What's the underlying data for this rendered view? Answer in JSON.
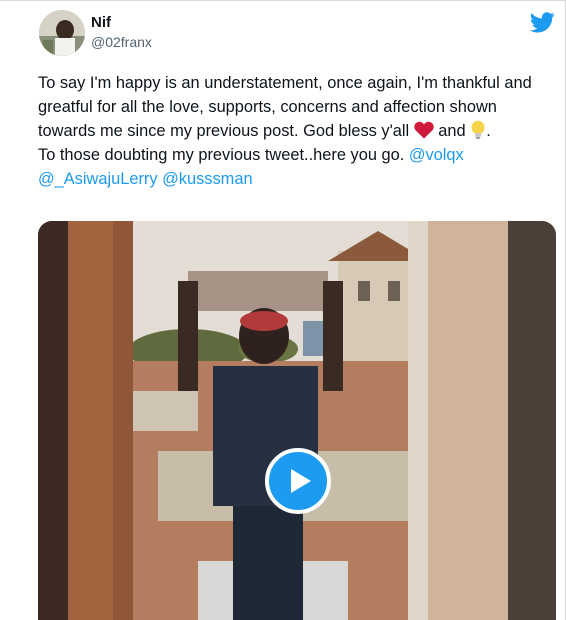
{
  "tweet": {
    "author_name": "Nif",
    "author_handle": "@02franx",
    "text_line1_a": "To say I'm happy is an understatement, once again, I'm thankful and greatful for all the love, supports, concerns  and affection shown towards me since my previous post. God bless y'all ",
    "text_line1_b": " and ",
    "text_line1_c": ".",
    "text_line2": "To those doubting my previous tweet..here you go. ",
    "mentions": [
      "@volqx",
      "@_AsiwajuLerry",
      "@kusssman"
    ],
    "emoji_1": "heart-icon",
    "emoji_2": "lightbulb-icon"
  },
  "colors": {
    "accent": "#1d9bf0",
    "text": "#0f1419",
    "secondary": "#536471",
    "heart": "#d11a3a"
  },
  "icons": {
    "logo": "twitter-bird-icon",
    "play": "play-icon"
  }
}
